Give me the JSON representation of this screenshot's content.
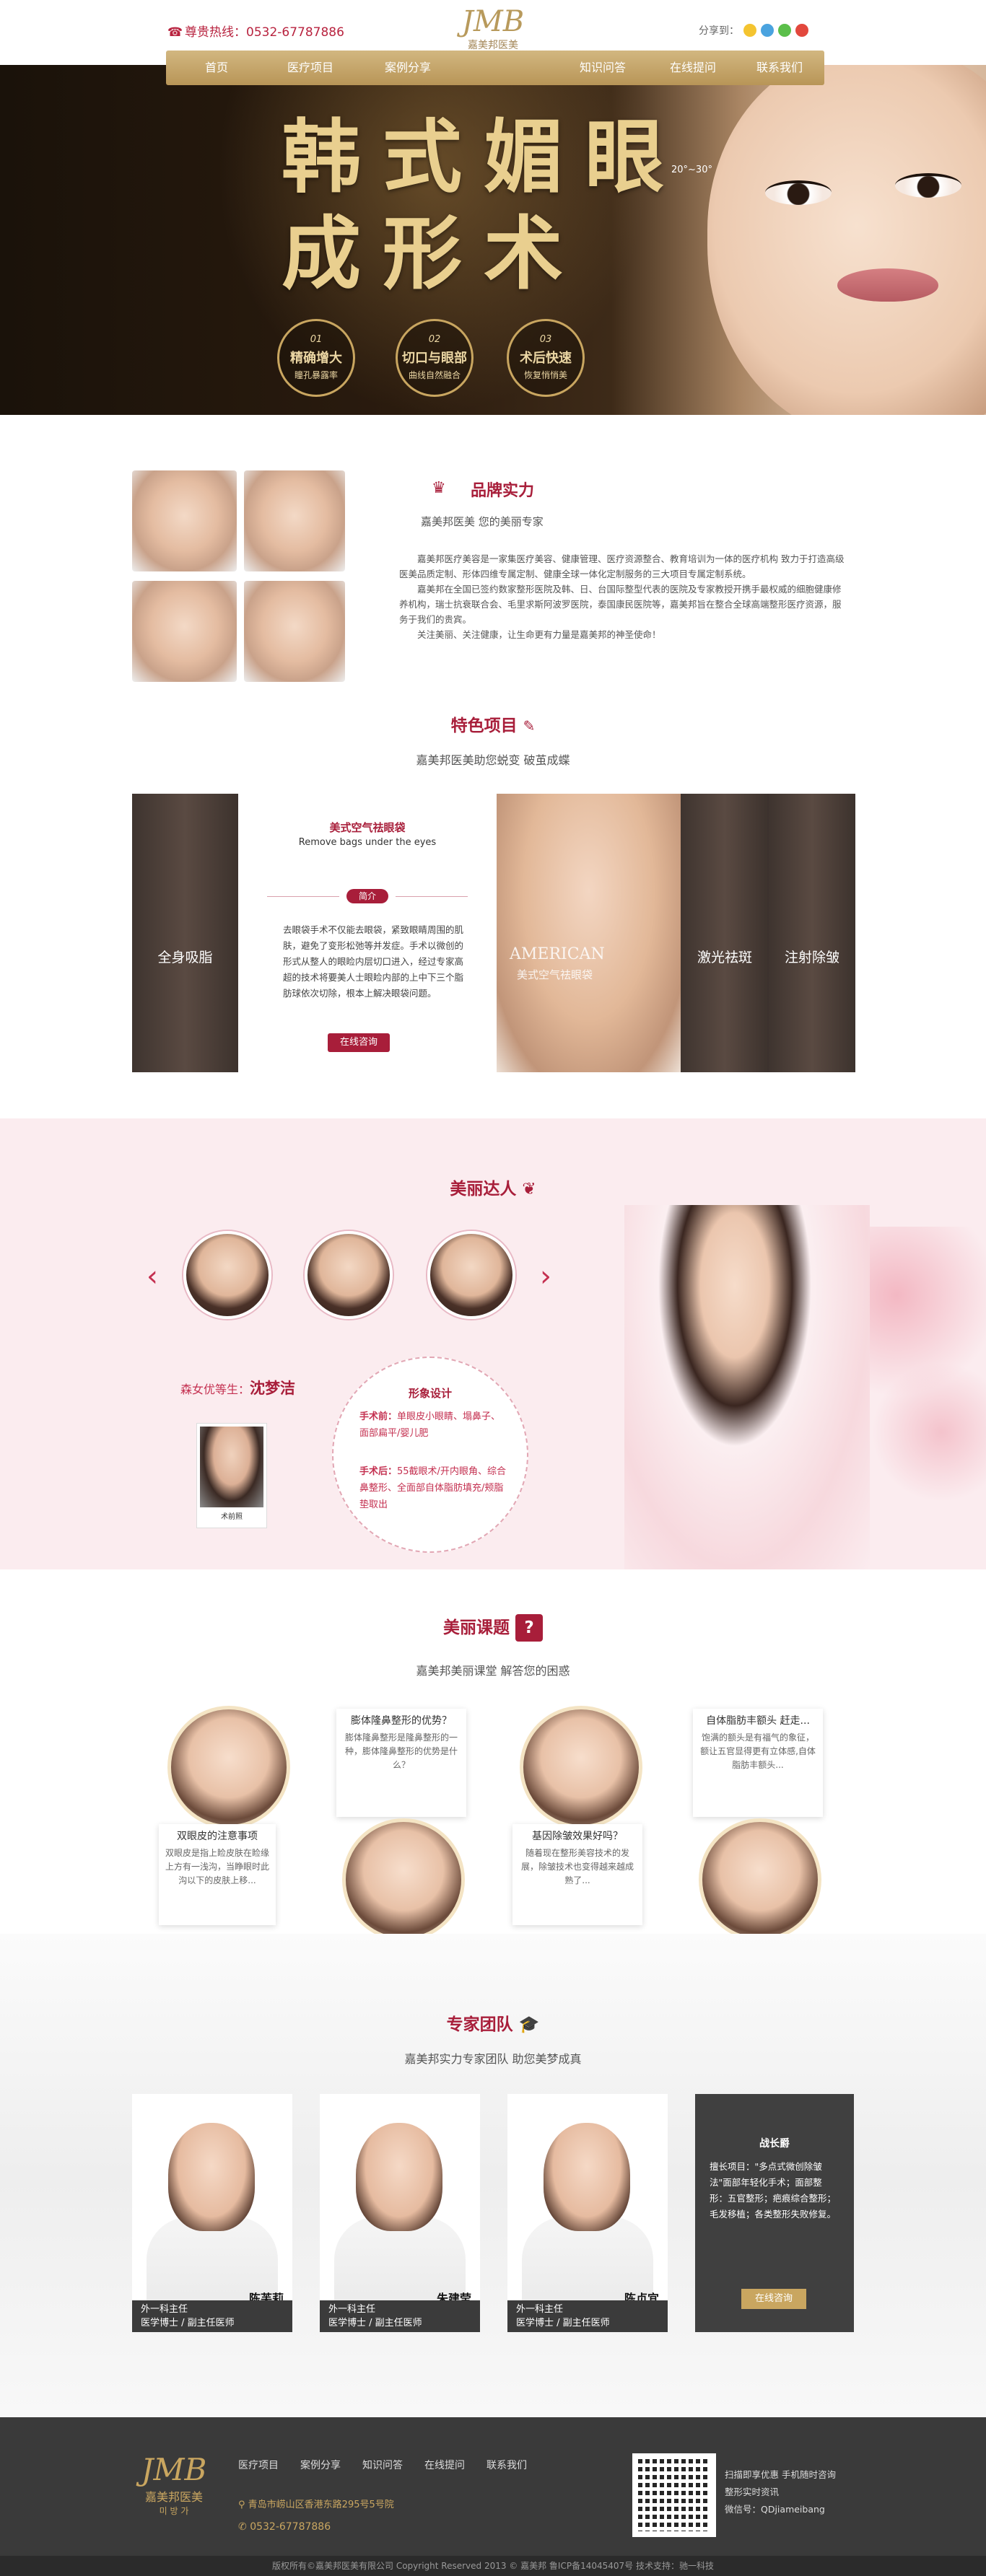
{
  "header": {
    "hotline_label": "尊贵热线：",
    "hotline_number": "0532-67787886",
    "logo_mark": "JMB",
    "logo_name": "嘉美邦医美",
    "share_label": "分享到："
  },
  "nav": [
    "首页",
    "医疗项目",
    "案例分享",
    "",
    "知识问答",
    "在线提问",
    "联系我们"
  ],
  "hero": {
    "title_line1": "韩式媚眼",
    "title_line2": "成形术",
    "angle": "20°~30°",
    "badges": [
      {
        "num": "01",
        "a": "精确增大",
        "b": "瞳孔暴露率"
      },
      {
        "num": "02",
        "a": "切口与眼部",
        "b": "曲线自然融合"
      },
      {
        "num": "03",
        "a": "术后快速",
        "b": "恢复悄悄美"
      }
    ]
  },
  "brand": {
    "title": "品牌实力",
    "subtitle": "嘉美邦医美  您的美丽专家",
    "paragraphs": [
      "嘉美邦医疗美容是一家集医疗美容、健康管理、医疗资源整合、教育培训为一体的医疗机构 致力于打造高级医美品质定制、形体四维专属定制、健康全球一体化定制服务的三大项目专属定制系统。",
      "嘉美邦在全国已签约数家整形医院及韩、日、台国际整型代表的医院及专家教授开携手最权威的细胞健康修养机构，瑞士抗衰联合会、毛里求斯阿波罗医院，泰国康民医院等，嘉美邦旨在整合全球高端整形医疗资源，服务于我们的贵宾。",
      "关注美丽、关注健康，让生命更有力量是嘉美邦的神圣使命！"
    ]
  },
  "features": {
    "title": "特色项目",
    "subtitle": "嘉美邦医美助您蜕变  破茧成蝶",
    "left_label": "全身吸脂",
    "card_title": "美式空气祛眼袋",
    "card_en": "Remove bags under the eyes",
    "card_tag": "简介",
    "card_text": "去眼袋手术不仅能去眼袋，紧致眼睛周围的肌肤，避免了变形松弛等并发症。手术以微创的形式从整人的眼睑内层切口进入，经过专家高超的技术将要美人士眼睑内部的上中下三个脂肪球依次切除，根本上解决眼袋问题。",
    "card_button": "在线咨询",
    "img_text_en": "AMERICAN",
    "img_text_cn": "美式空气祛眼袋",
    "right_label1": "激光祛斑",
    "right_label2": "注射除皱"
  },
  "beauty": {
    "title": "美丽达人",
    "prefix": "森女优等生：",
    "name": "沈梦洁",
    "thumb_caption": "术前照",
    "design_title": "形象设计",
    "before_label": "手术前：",
    "before_text": "单眼皮小眼睛、塌鼻子、面部扁平/婴儿肥",
    "after_label": "手术后：",
    "after_text": "55截眼术/开内眼角、综合鼻整形、全面部自体脂肪填充/颊脂垫取出"
  },
  "classroom": {
    "title": "美丽课题",
    "subtitle": "嘉美邦美丽课堂  解答您的困惑",
    "cards": [
      {
        "title": "双眼皮的注意事项",
        "text": "双眼皮是指上睑皮肤在睑缘上方有一浅沟，当睁眼时此沟以下的皮肤上移..."
      },
      {
        "title": "膨体隆鼻整形的优势？",
        "text": "膨体隆鼻整形是隆鼻整形的一种，膨体隆鼻整形的优势是什么？"
      },
      {
        "title": "基因除皱效果好吗？",
        "text": "随着现在整形美容技术的发展，除皱技术也变得越来越成熟了..."
      },
      {
        "title": "自体脂肪丰额头 赶走...",
        "text": "饱满的额头是有福气的象征，额让五官显得更有立体感,自体脂肪丰额头..."
      }
    ]
  },
  "team": {
    "title": "专家团队",
    "subtitle": "嘉美邦实力专家团队  助您美梦成真",
    "doctors": [
      {
        "name": "陈芙莉",
        "dept": "外一科主任",
        "title": "医学博士 / 副主任医师"
      },
      {
        "name": "朱建莹",
        "dept": "外一科主任",
        "title": "医学博士 / 副主任医师"
      },
      {
        "name": "陈贞宜",
        "dept": "外一科主任",
        "title": "医学博士 / 副主任医师"
      }
    ],
    "leader": {
      "name": "战长爵",
      "text": "擅长项目：\"多点式微创除皱法\"面部年轻化手术；面部整形：五官整形；疤痕综合整形；毛发移植；各类整形失败修复。",
      "button": "在线咨询"
    }
  },
  "footer": {
    "links": [
      "医疗项目",
      "案例分享",
      "知识问答",
      "在线提问",
      "联系我们"
    ],
    "address": "青岛市崂山区香港东路295号5号院",
    "phone": "0532-67787886",
    "qr_line1": "扫描即享优惠 手机随时咨询",
    "qr_line2": "整形实时资讯",
    "qr_line3": "微信号：QDjiameibang",
    "logo_sub": "미 방 가",
    "copyright": "版权所有©嘉美邦医美有限公司    Copyright Reserved 2013 © 嘉美邦    鲁ICP备14045407号    技术支持：驰一科技"
  },
  "colors": {
    "brand_red": "#a81e3a",
    "gold": "#c9a660",
    "nav_gold": "#b89557"
  },
  "icons": [
    "phone-icon",
    "crown-icon",
    "pen-icon",
    "lady-silhouette-icon",
    "question-icon",
    "graduation-cap-icon",
    "location-icon",
    "qr-code-icon"
  ]
}
